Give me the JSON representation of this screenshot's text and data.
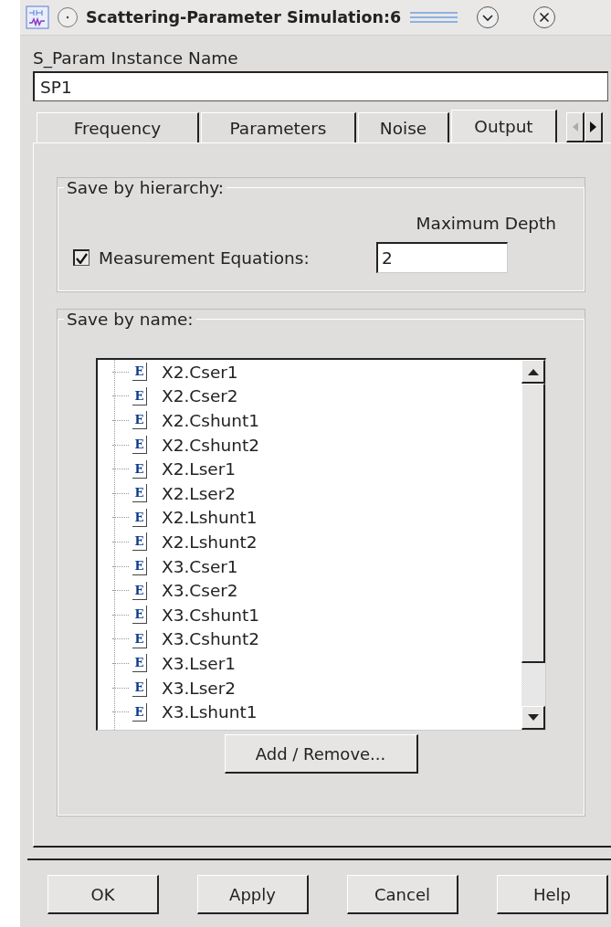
{
  "window": {
    "title": "Scattering-Parameter Simulation:6"
  },
  "instance_name": {
    "label": "S_Param Instance Name",
    "value": "SP1"
  },
  "tabs": [
    {
      "label": "Frequency",
      "selected": false
    },
    {
      "label": "Parameters",
      "selected": false
    },
    {
      "label": "Noise",
      "selected": false
    },
    {
      "label": "Output",
      "selected": true
    }
  ],
  "save_by_hierarchy": {
    "title": "Save by hierarchy:",
    "depth_label": "Maximum Depth",
    "checkbox_label": "Measurement Equations:",
    "checked": true,
    "depth_value": "2"
  },
  "save_by_name": {
    "title": "Save by name:",
    "items": [
      {
        "icon": "E",
        "label": "X2.Cser1"
      },
      {
        "icon": "E",
        "label": "X2.Cser2"
      },
      {
        "icon": "E",
        "label": "X2.Cshunt1"
      },
      {
        "icon": "E",
        "label": "X2.Cshunt2"
      },
      {
        "icon": "E",
        "label": "X2.Lser1"
      },
      {
        "icon": "E",
        "label": "X2.Lser2"
      },
      {
        "icon": "E",
        "label": "X2.Lshunt1"
      },
      {
        "icon": "E",
        "label": "X2.Lshunt2"
      },
      {
        "icon": "E",
        "label": "X3.Cser1"
      },
      {
        "icon": "E",
        "label": "X3.Cser2"
      },
      {
        "icon": "E",
        "label": "X3.Cshunt1"
      },
      {
        "icon": "E",
        "label": "X3.Cshunt2"
      },
      {
        "icon": "E",
        "label": "X3.Lser1"
      },
      {
        "icon": "E",
        "label": "X3.Lser2"
      },
      {
        "icon": "E",
        "label": "X3.Lshunt1"
      }
    ],
    "button": "Add / Remove..."
  },
  "buttons": [
    "OK",
    "Apply",
    "Cancel",
    "Help"
  ]
}
